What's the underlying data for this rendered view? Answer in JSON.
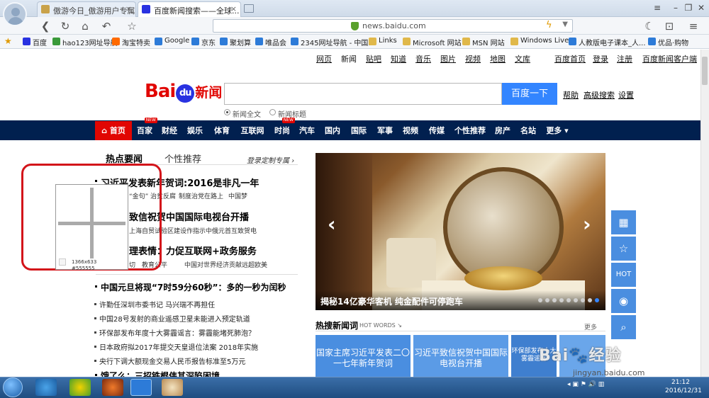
{
  "browser": {
    "tabs": [
      {
        "title": "傲游今日_傲游用户专属..."
      },
      {
        "title": "百度新闻搜索——全球..."
      }
    ],
    "url": "news.baidu.com",
    "bookmarks": [
      "百度",
      "hao123网址导航",
      "淘宝特卖",
      "Google",
      "京东",
      "聚划算",
      "唯品会",
      "2345网址导航 - 中国...",
      "Links",
      "Microsoft 网站",
      "MSN 网站",
      "Windows Live",
      "人教版电子课本_人...",
      "优品·购物"
    ]
  },
  "topnav": {
    "links": [
      "网页",
      "新闻",
      "贴吧",
      "知道",
      "音乐",
      "图片",
      "视频",
      "地图",
      "文库"
    ],
    "right": [
      "百度首页",
      "登录",
      "注册",
      "百度新闻客户端"
    ]
  },
  "logo": {
    "bai": "Bai",
    "du": "du",
    "news": "新闻"
  },
  "search": {
    "button": "百度一下",
    "links": [
      "帮助",
      "高级搜索",
      "设置"
    ],
    "radios": [
      "新闻全文",
      "新闻标题"
    ]
  },
  "channels": [
    {
      "label": "首页"
    },
    {
      "label": "百家",
      "badge": "NEW"
    },
    {
      "label": "财经"
    },
    {
      "label": "娱乐"
    },
    {
      "label": "体育"
    },
    {
      "label": "互联网"
    },
    {
      "label": "时尚",
      "badge": "NEW"
    },
    {
      "label": "汽车"
    },
    {
      "label": "国内"
    },
    {
      "label": "国际"
    },
    {
      "label": "军事"
    },
    {
      "label": "视频"
    },
    {
      "label": "传媒"
    },
    {
      "label": "个性推荐"
    },
    {
      "label": "房产"
    },
    {
      "label": "名站"
    },
    {
      "label": "更多"
    }
  ],
  "left": {
    "tab_hot": "热点要闻",
    "tab_personal": "个性推荐",
    "login_prompt": "登录定制专属",
    "headlines": [
      {
        "title": "习近平发表新年贺词:2016是非凡一年",
        "subs": [
          "“金句”",
          "治贫反腐",
          "制度治党在路上",
          "中国梦"
        ]
      },
      {
        "title": "致信祝贺中国国际电视台开播",
        "subs": [
          "上海自贸试验区建设作指示",
          "中俄元首互致贺电"
        ]
      },
      {
        "title": "理表情：力促互联网+政务服务",
        "subs": [
          "切",
          "教育公平",
          "中国对世界经济贡献远超欧美"
        ]
      },
      {
        "title": "中国元旦将现“7时59分60秒”：多的一秒为闰秒",
        "subs": []
      }
    ],
    "items": [
      "许勤任深圳市委书记 马兴瑞不再担任",
      "中国28号发射的商业遥感卫星未能进入预定轨道",
      "环保部发布年度十大雾霾谣言：雾霾能堵死肺泡？",
      "日本政府拟2017年提交天皇退位法案 2018年实施",
      "央行下调大额现金交易人民币报告标准至5万元"
    ],
    "cutoff": "饿了么：三招铁棍伟其深陷困境"
  },
  "magnifier": {
    "size": "1366x633",
    "color": "#555555"
  },
  "slider": {
    "caption": "揭秘14亿豪华客机 纯金配件可停跑车",
    "dots": 9,
    "active": 8
  },
  "hot": {
    "title": "热搜新闻词",
    "sub": "HOT WORDS",
    "more": "更多",
    "boxes": [
      "国家主席习近平发表二〇一七年新年贺词",
      "习近平致信祝贺中国国际电视台开播",
      "环保部发布十大雾霾谣言"
    ]
  },
  "side": {
    "hot": "HOT"
  },
  "watermark": {
    "main": "Bai🐾经验",
    "sub": "jingyan.baidu.com"
  },
  "clock": {
    "time": "21:12",
    "date": "2016/12/31"
  },
  "colors": {
    "nav": "#01204f",
    "red": "#e10602",
    "blue": "#3385ff"
  }
}
